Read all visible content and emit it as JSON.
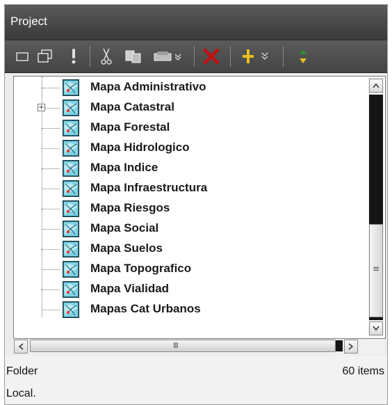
{
  "window": {
    "title": "Project"
  },
  "toolbar": {
    "buttons": [
      {
        "name": "new-window-icon"
      },
      {
        "name": "cascade-windows-icon"
      },
      {
        "name": "info-icon"
      },
      {
        "name": "cut-icon"
      },
      {
        "name": "copy-icon"
      },
      {
        "name": "paste-dropdown-icon"
      },
      {
        "name": "delete-icon"
      },
      {
        "name": "add-dropdown-icon"
      },
      {
        "name": "refresh-icon"
      }
    ]
  },
  "tree": {
    "items": [
      {
        "label": "Mapa Administrativo"
      },
      {
        "label": "Mapa Catastral",
        "expandable": true
      },
      {
        "label": "Mapa Forestal"
      },
      {
        "label": "Mapa Hidrologico"
      },
      {
        "label": "Mapa Indice"
      },
      {
        "label": "Mapa Infraestructura"
      },
      {
        "label": "Mapa Riesgos"
      },
      {
        "label": "Mapa Social"
      },
      {
        "label": "Mapa Suelos"
      },
      {
        "label": "Mapa Topografico"
      },
      {
        "label": "Mapa Vialidad"
      },
      {
        "label": "Mapas Cat Urbanos"
      }
    ],
    "expander_symbol": "+"
  },
  "hscroll": {
    "grip": "III"
  },
  "vscroll": {
    "grip": "≡"
  },
  "status": {
    "type": "Folder",
    "count": "60 items",
    "location": "Local."
  },
  "colors": {
    "accent_red": "#c01010",
    "accent_yellow": "#e6c020",
    "accent_green": "#2f8f2f"
  }
}
